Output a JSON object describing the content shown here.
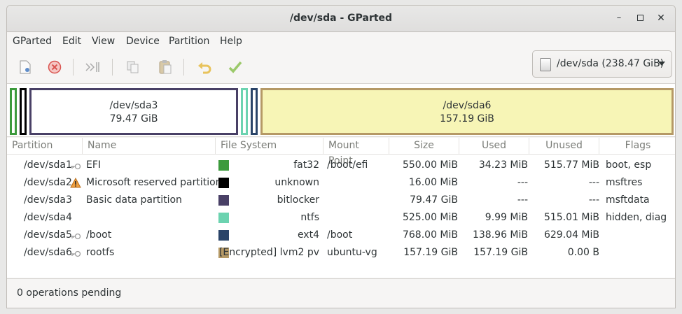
{
  "window": {
    "title": "/dev/sda - GParted"
  },
  "menu": [
    "GParted",
    "Edit",
    "View",
    "Device",
    "Partition",
    "Help"
  ],
  "device_selector": {
    "label": "/dev/sda (238.47 GiB)"
  },
  "diskmap": {
    "sda3": {
      "name": "/dev/sda3",
      "size": "79.47 GiB"
    },
    "sda6": {
      "name": "/dev/sda6",
      "size": "157.19 GiB"
    }
  },
  "columns": [
    "Partition",
    "Name",
    "File System",
    "Mount Point",
    "Size",
    "Used",
    "Unused",
    "Flags"
  ],
  "rows": [
    {
      "partition": "/dev/sda1",
      "name": "EFI",
      "fs": "fat32",
      "fs_color": "#3c9a3c",
      "mount": "/boot/efi",
      "size": "550.00 MiB",
      "used": "34.23 MiB",
      "unused": "515.77 MiB",
      "flags": "boot, esp"
    },
    {
      "partition": "/dev/sda2",
      "name": "Microsoft reserved partition",
      "fs": "unknown",
      "fs_color": "#000000",
      "mount": "",
      "size": "16.00 MiB",
      "used": "---",
      "unused": "---",
      "flags": "msftres"
    },
    {
      "partition": "/dev/sda3",
      "name": "Basic data partition",
      "fs": "bitlocker",
      "fs_color": "#494066",
      "mount": "",
      "size": "79.47 GiB",
      "used": "---",
      "unused": "---",
      "flags": "msftdata"
    },
    {
      "partition": "/dev/sda4",
      "name": "",
      "fs": "ntfs",
      "fs_color": "#6cd3b0",
      "mount": "",
      "size": "525.00 MiB",
      "used": "9.99 MiB",
      "unused": "515.01 MiB",
      "flags": "hidden, diag"
    },
    {
      "partition": "/dev/sda5",
      "name": "/boot",
      "fs": "ext4",
      "fs_color": "#2a4468",
      "mount": "/boot",
      "size": "768.00 MiB",
      "used": "138.96 MiB",
      "unused": "629.04 MiB",
      "flags": ""
    },
    {
      "partition": "/dev/sda6",
      "name": "rootfs",
      "fs": "[Encrypted] lvm2 pv",
      "fs_color": "#b59966",
      "mount": "ubuntu-vg",
      "size": "157.19 GiB",
      "used": "157.19 GiB",
      "unused": "0.00 B",
      "flags": ""
    }
  ],
  "status": {
    "text": "0 operations pending"
  }
}
